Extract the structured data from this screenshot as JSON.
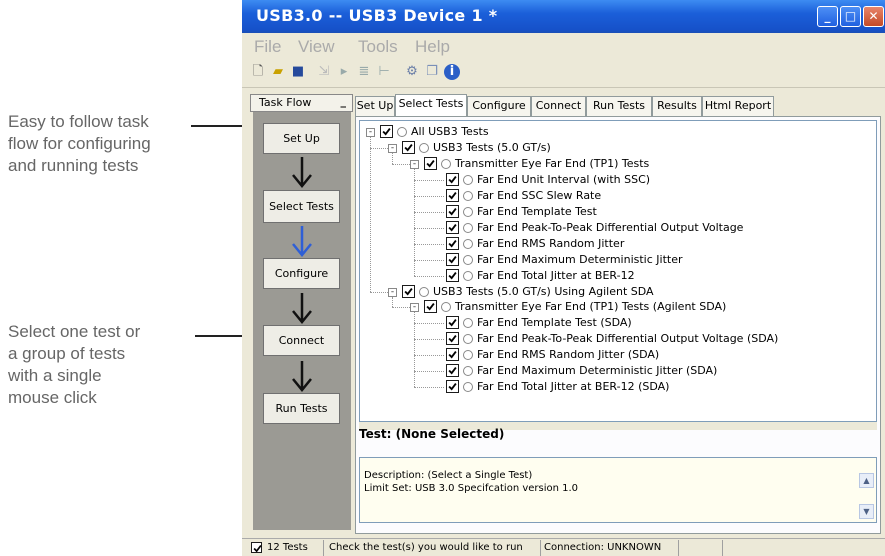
{
  "window": {
    "title": "USB3.0 -- USB3 Device 1 *",
    "controls": [
      "minimize-icon",
      "maximize-icon",
      "close-icon"
    ]
  },
  "menu": [
    "File",
    "View",
    "Tools",
    "Help"
  ],
  "toolbar_icons": [
    "new-file-icon",
    "open-folder-icon",
    "save-icon",
    "export-icon",
    "run-icon",
    "filter-icon",
    "marker-icon",
    "settings-icon",
    "copy-icon",
    "info-icon"
  ],
  "callouts": [
    [
      "Easy to follow task",
      "flow for configuring",
      "and running tests"
    ],
    [
      "Select one test or",
      "a group of tests",
      "with a single",
      "mouse click"
    ]
  ],
  "taskflow": {
    "header": "Task Flow",
    "collapse": "_",
    "steps": [
      "Set Up",
      "Select Tests",
      "Configure",
      "Connect",
      "Run Tests"
    ]
  },
  "tabs": [
    "Set Up",
    "Select Tests",
    "Configure",
    "Connect",
    "Run Tests",
    "Results",
    "Html Report"
  ],
  "active_tab": "Select Tests",
  "tree": [
    {
      "label": "All USB3 Tests",
      "level": 0,
      "expander": "-",
      "checked": true
    },
    {
      "label": "USB3 Tests (5.0 GT/s)",
      "level": 1,
      "expander": "-",
      "checked": true
    },
    {
      "label": "Transmitter Eye Far End (TP1) Tests",
      "level": 2,
      "expander": "-",
      "checked": true
    },
    {
      "label": "Far End Unit Interval (with SSC)",
      "level": 3,
      "checked": true
    },
    {
      "label": "Far End SSC Slew Rate",
      "level": 3,
      "checked": true
    },
    {
      "label": "Far End Template Test",
      "level": 3,
      "checked": true
    },
    {
      "label": "Far End Peak-To-Peak Differential Output Voltage",
      "level": 3,
      "checked": true
    },
    {
      "label": "Far End RMS Random Jitter",
      "level": 3,
      "checked": true
    },
    {
      "label": "Far End Maximum Deterministic Jitter",
      "level": 3,
      "checked": true
    },
    {
      "label": "Far End Total Jitter at BER-12",
      "level": 3,
      "checked": true
    },
    {
      "label": "USB3 Tests (5.0 GT/s) Using Agilent SDA",
      "level": 1,
      "expander": "-",
      "checked": true
    },
    {
      "label": "Transmitter Eye Far End (TP1) Tests (Agilent SDA)",
      "level": 2,
      "expander": "-",
      "checked": true
    },
    {
      "label": "Far End Template Test (SDA)",
      "level": 3,
      "checked": true
    },
    {
      "label": "Far End Peak-To-Peak Differential Output Voltage (SDA)",
      "level": 3,
      "checked": true
    },
    {
      "label": "Far End RMS Random Jitter (SDA)",
      "level": 3,
      "checked": true
    },
    {
      "label": "Far End Maximum Deterministic Jitter (SDA)",
      "level": 3,
      "checked": true
    },
    {
      "label": "Far End Total Jitter at BER-12 (SDA)",
      "level": 3,
      "checked": true
    }
  ],
  "test_panel": {
    "title": "Test: (None Selected)",
    "description": "Description: (Select a Single Test)",
    "limit_set": "Limit Set: USB 3.0 Specifcation version 1.0"
  },
  "status": {
    "count": "12 Tests",
    "message": "Check the test(s) you would like to run",
    "connection": "Connection: UNKNOWN"
  }
}
